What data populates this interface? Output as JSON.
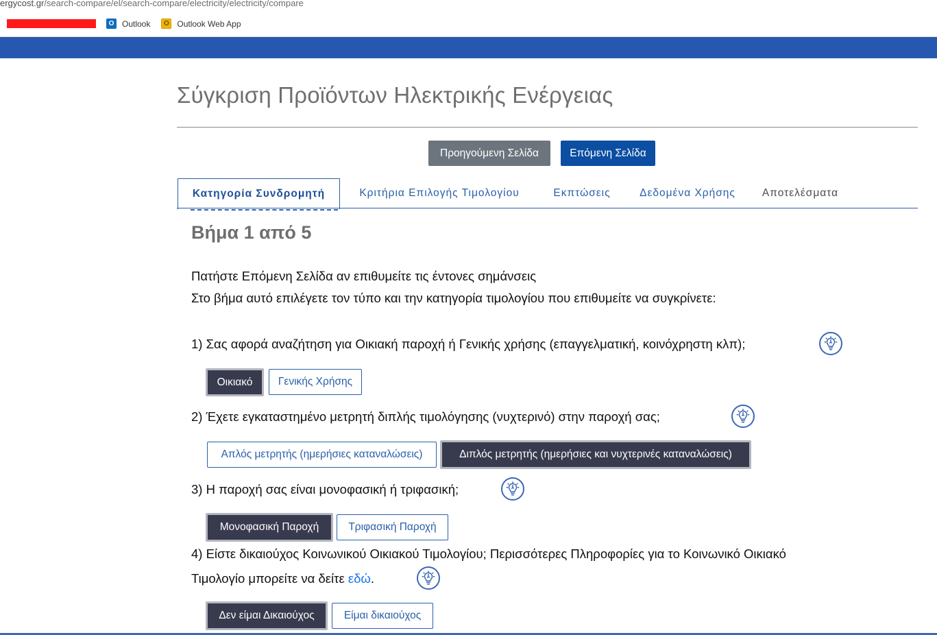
{
  "browser": {
    "url_domain": "ergycost.gr",
    "url_path": "/search-compare/el/search-compare/electricity/electricity/compare",
    "bookmarks": [
      {
        "label": "Outlook",
        "icon": "outlook-icon"
      },
      {
        "label": "Outlook Web App",
        "icon": "outlook-web-app-icon"
      }
    ]
  },
  "theme": {
    "header_blue": "#2558ae",
    "primary": "#0b4ea2",
    "secondary": "#6c757d",
    "selected_option": "#383a4e",
    "link": "#1a73e8"
  },
  "page": {
    "title": "Σύγκριση Προϊόντων Ηλεκτρικής Ενέργειας",
    "prev_button": "Προηγούμενη Σελίδα",
    "next_button": "Επόμενη Σελίδα"
  },
  "tabs": [
    {
      "label": "Κατηγορία Συνδρομητή",
      "active": true
    },
    {
      "label": "Κριτήρια Επιλογής Τιμολογίου",
      "active": false
    },
    {
      "label": "Εκπτώσεις",
      "active": false
    },
    {
      "label": "Δεδομένα Χρήσης",
      "active": false
    },
    {
      "label": "Αποτελέσματα",
      "active": false
    }
  ],
  "step": {
    "title": "Βήμα 1 από 5",
    "intro_line1": "Πατήστε Επόμενη Σελίδα αν επιθυμείτε τις έντονες σημάνσεις",
    "intro_line2": "Στο βήμα αυτό επιλέγετε τον τύπο και την κατηγορία τιμολογίου που επιθυμείτε να συγκρίνετε:"
  },
  "questions": [
    {
      "text": "1) Σας αφορά αναζήτηση για Οικιακή παροχή ή Γενικής χρήσης (επαγγελματική, κοινόχρηστη κλπ);",
      "options": [
        {
          "label": "Οικιακό",
          "selected": true
        },
        {
          "label": "Γενικής Χρήσης",
          "selected": false
        }
      ]
    },
    {
      "text": "2) Έχετε εγκαταστημένο μετρητή διπλής τιμολόγησης (νυχτερινό) στην παροχή σας;",
      "options": [
        {
          "label": "Απλός μετρητής (ημερήσιες καταναλώσεις)",
          "selected": false
        },
        {
          "label": "Διπλός μετρητής (ημερήσιες και νυχτερινές καταναλώσεις)",
          "selected": true
        }
      ]
    },
    {
      "text": "3) Η παροχή σας είναι μονοφασική ή τριφασική;",
      "options": [
        {
          "label": "Μονοφασική Παροχή",
          "selected": true
        },
        {
          "label": "Τριφασική Παροχή",
          "selected": false
        }
      ]
    },
    {
      "text_line1": "4) Είστε δικαιούχος Κοινωνικού Οικιακού Τιμολογίου; Περισσότερες Πληροφορίες για το Κοινωνικό Οικιακό",
      "text_line2": "Τιμολογίο μπορείτε να δείτε",
      "link": "εδώ",
      "text_end": ".",
      "options": [
        {
          "label": "Δεν είμαι Δικαιούχος",
          "selected": true
        },
        {
          "label": "Είμαι δικαιούχος",
          "selected": false
        }
      ]
    }
  ],
  "help_icon": "lightbulb-icon"
}
